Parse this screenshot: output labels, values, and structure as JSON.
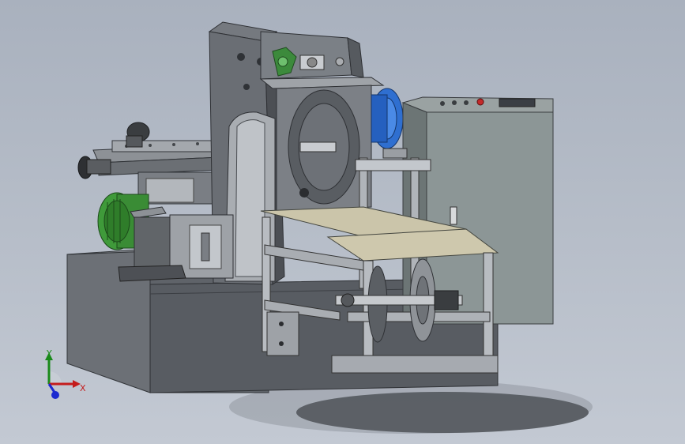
{
  "viewport": {
    "background_top": "#a9b1be",
    "background_bottom": "#c3c9d3"
  },
  "colors": {
    "steel_dark": "#5e6268",
    "steel_mid": "#8a8f96",
    "steel_light": "#b9bdc3",
    "panel_gray": "#8c9696",
    "motor_green": "#3f9a3a",
    "pulley_blue": "#2f6fd0",
    "plate_tan": "#c8c2a8",
    "stop_red": "#c42a2a"
  },
  "triad": {
    "x_label": "X",
    "y_label": "Y",
    "x_color": "#c41c1c",
    "y_color": "#1a8a1a",
    "z_color": "#1c2ad0"
  }
}
